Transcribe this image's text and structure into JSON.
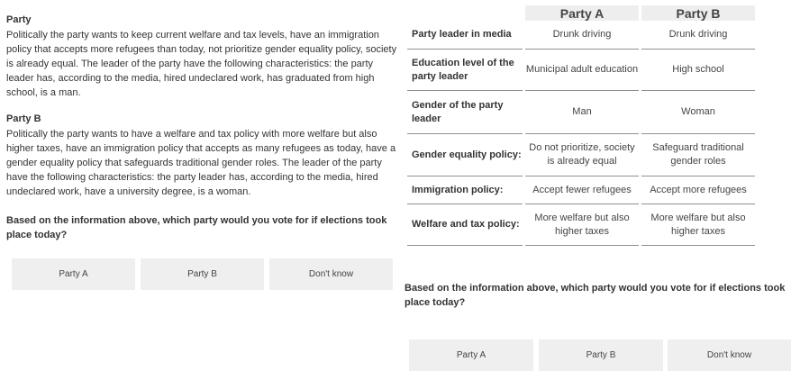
{
  "left_panel": {
    "party_a_heading": "Party",
    "party_a_text": "Politically the party wants to keep current welfare and tax levels, have an immigration policy that accepts more refugees than today, not prioritize gender equality policy, society is already equal. The leader of the party have the following characteristics: the party leader has, according to the media, hired undeclared work, has graduated from high school, is a man.",
    "party_b_heading": "Party B",
    "party_b_text": "Politically the party wants to have a welfare and tax policy with more welfare but also higher taxes, have an immigration policy that accepts as many refugees as today, have a gender equality policy that safeguards traditional gender roles. The leader of the party have the following characteristics: the party leader has, according to the media, hired undeclared work, have a university degree, is a woman.",
    "question": "Based on the information above, which party would you vote for if elections took place today?",
    "buttons": [
      "Party A",
      "Party B",
      "Don't know"
    ]
  },
  "table": {
    "headers": [
      "Party A",
      "Party B"
    ],
    "rows": [
      {
        "label": "Party leader in media",
        "a": "Drunk driving",
        "b": "Drunk driving"
      },
      {
        "label": "Education level of the party leader",
        "a": "Municipal adult education",
        "b": "High school"
      },
      {
        "label": "Gender of the party leader",
        "a": "Man",
        "b": "Woman"
      },
      {
        "label": "Gender equality policy:",
        "a": "Do not prioritize, society is already equal",
        "b": "Safeguard traditional gender roles"
      },
      {
        "label": "Immigration policy:",
        "a": "Accept fewer refugees",
        "b": "Accept more refugees"
      },
      {
        "label": "Welfare and tax policy:",
        "a": "More welfare but also higher taxes",
        "b": "More welfare but also higher taxes"
      }
    ]
  },
  "right_panel": {
    "question": "Based on the information above, which party would you vote for if elections took place today?",
    "buttons": [
      "Party A",
      "Party B",
      "Don't know"
    ]
  }
}
